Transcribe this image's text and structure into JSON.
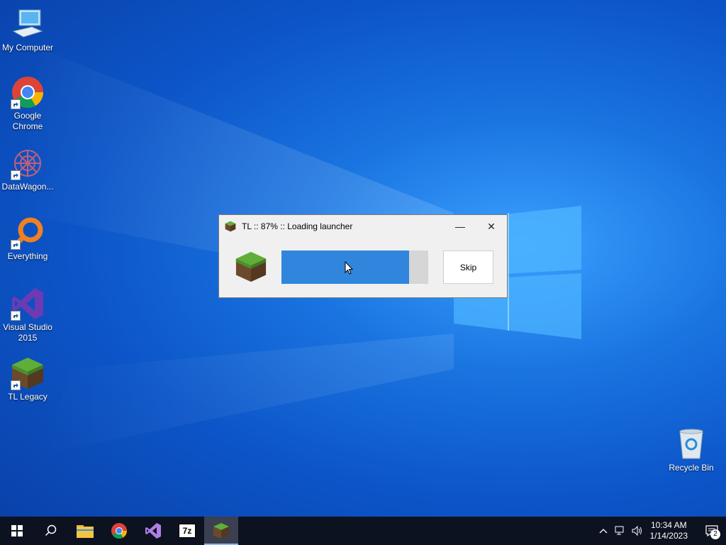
{
  "desktop": {
    "icons": [
      {
        "label": "My Computer",
        "icon": "computer-icon"
      },
      {
        "label": "Google Chrome",
        "icon": "chrome-icon"
      },
      {
        "label": "DataWagon...",
        "icon": "datawagon-icon"
      },
      {
        "label": "Everything",
        "icon": "everything-search-icon"
      },
      {
        "label": "Visual Studio 2015",
        "icon": "visual-studio-icon"
      },
      {
        "label": "TL Legacy",
        "icon": "grass-block-icon"
      },
      {
        "label": "Recycle Bin",
        "icon": "recycle-bin-icon"
      }
    ]
  },
  "loader_window": {
    "title": "TL :: 87% :: Loading launcher",
    "progress": 0.87,
    "skip_label": "Skip",
    "minimize_glyph": "—",
    "close_glyph": "✕"
  },
  "taskbar": {
    "buttons": [
      "start-icon",
      "search-icon",
      "file-explorer-icon",
      "chrome-icon",
      "visual-studio-icon",
      "7zip-icon",
      "tl-legacy-icon"
    ],
    "sevenzip_text": "7z",
    "clock": {
      "time": "10:34 AM",
      "date": "1/14/2023"
    },
    "notification_count": "2"
  },
  "colors": {
    "accent": "#2f86dc",
    "taskbar": "#0c1220"
  }
}
